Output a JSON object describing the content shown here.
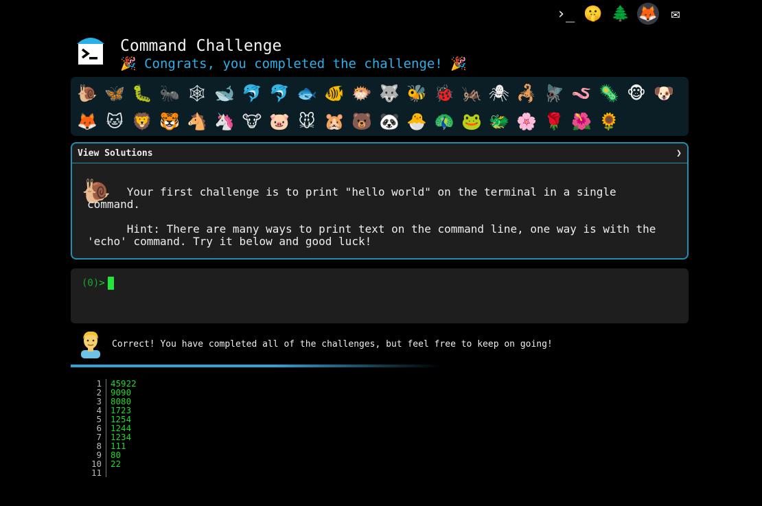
{
  "top_icons": [
    {
      "name": "terminal-logo-icon",
      "glyph": "›_"
    },
    {
      "name": "shushing-face-icon",
      "glyph": "🤫"
    },
    {
      "name": "tree-icon",
      "glyph": "🌲"
    },
    {
      "name": "gitlab-icon",
      "glyph": "🦊"
    },
    {
      "name": "mail-icon",
      "glyph": "✉"
    }
  ],
  "header": {
    "title": "Command Challenge",
    "congrats": "🎉 Congrats, you completed the challenge! 🎉"
  },
  "animals": [
    "🐌",
    "🦋",
    "🐛",
    "🐜",
    "🕸",
    "🐋",
    "🐬",
    "🐬",
    "🐟",
    "🐠",
    "🐡",
    "🐺",
    "🐝",
    "🐞",
    "🦗",
    "🕷",
    "🦂",
    "🪰",
    "🪱",
    "🦠",
    "🐵",
    "🐶",
    "🦊",
    "🐱",
    "🦁",
    "🐯",
    "🐴",
    "🦄",
    "🐮",
    "🐷",
    "🐭",
    "🐹",
    "🐻",
    "🐼",
    "🐣",
    "🦚",
    "🐸",
    "🐲",
    "🌸",
    "🌹",
    "🌺",
    "🌻"
  ],
  "solutions": {
    "label": "View Solutions",
    "chevron": "❯",
    "icon": "🐌",
    "challenge_text": "      Your first challenge is to print \"hello world\" on the terminal in a single command.",
    "hint_text": "      Hint: There are many ways to print text on the command line, one way is with the\n'echo' command. Try it below and good luck!"
  },
  "terminal": {
    "prompt_index": "(0)",
    "prompt_symbol": ">"
  },
  "result": {
    "message": "Correct! You have completed all of the challenges, but feel free to keep on going!"
  },
  "output": {
    "line_numbers": [
      "1",
      "2",
      "3",
      "4",
      "5",
      "6",
      "7",
      "8",
      "9",
      "10",
      "11"
    ],
    "lines": [
      "45922",
      "9090",
      "8080",
      "1723",
      "1254",
      "1244",
      "1234",
      "111",
      "80",
      "22",
      ""
    ]
  },
  "colors": {
    "accent": "#2ab0e8",
    "terminal_green": "#1fd82e",
    "panel_border": "#1f8fb5"
  }
}
